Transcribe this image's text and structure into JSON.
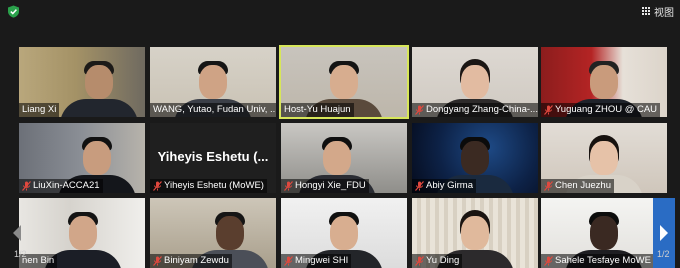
{
  "window": {
    "view_label": "视图",
    "view_icon": "grid-icon",
    "security_icon": "shield-icon",
    "security_color": "#2aa14b"
  },
  "pager": {
    "left_indicator": "1/2",
    "right_indicator": "1/2"
  },
  "participants": [
    {
      "name": "Liang Xi",
      "muted": false,
      "active": false,
      "video": true
    },
    {
      "name": "WANG, Yutao, Fudan Univ, ...",
      "muted": false,
      "active": false,
      "video": true
    },
    {
      "name": "Host-Yu Huajun",
      "muted": false,
      "active": true,
      "video": true
    },
    {
      "name": "Dongyang Zhang-China-...",
      "muted": true,
      "active": false,
      "video": true
    },
    {
      "name": "Yuguang ZHOU @ CAU",
      "muted": true,
      "active": false,
      "video": true
    },
    {
      "name": "LiuXin-ACCA21",
      "muted": true,
      "active": false,
      "video": true
    },
    {
      "name": "Yiheyis Eshetu (MoWE)",
      "muted": true,
      "active": false,
      "video": false,
      "placeholder_text": "Yiheyis Eshetu (..."
    },
    {
      "name": "Hongyi Xie_FDU",
      "muted": true,
      "active": false,
      "video": true
    },
    {
      "name": "Abiy Girma",
      "muted": true,
      "active": false,
      "video": true
    },
    {
      "name": "Chen Juezhu",
      "muted": true,
      "active": false,
      "video": true
    },
    {
      "name": "nen Bin",
      "muted": false,
      "active": false,
      "video": true
    },
    {
      "name": "Biniyam Zewdu",
      "muted": true,
      "active": false,
      "video": true
    },
    {
      "name": "Mingwei SHI",
      "muted": true,
      "active": false,
      "video": true
    },
    {
      "name": "Yu Ding",
      "muted": true,
      "active": false,
      "video": true
    },
    {
      "name": "Sahele Tesfaye MoWE",
      "muted": true,
      "active": false,
      "video": true
    }
  ],
  "colors": {
    "active_border": "#d7e65a",
    "mute_icon": "#e0483e",
    "next_page": "#2a6cc4"
  }
}
